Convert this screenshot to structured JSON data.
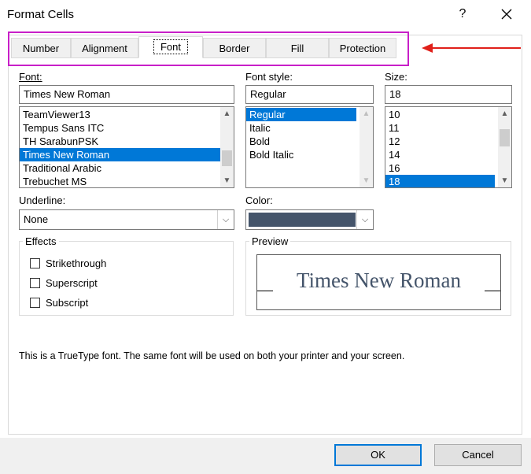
{
  "window": {
    "title": "Format Cells",
    "help": "?"
  },
  "tabs": [
    {
      "label": "Number"
    },
    {
      "label": "Alignment"
    },
    {
      "label": "Font",
      "active": true
    },
    {
      "label": "Border"
    },
    {
      "label": "Fill"
    },
    {
      "label": "Protection"
    }
  ],
  "font": {
    "label": "Font:",
    "value": "Times New Roman",
    "items": [
      "TeamViewer13",
      "Tempus Sans ITC",
      "TH SarabunPSK",
      "Times New Roman",
      "Traditional Arabic",
      "Trebuchet MS"
    ],
    "selected_index": 3
  },
  "font_style": {
    "label": "Font style:",
    "value": "Regular",
    "items": [
      "Regular",
      "Italic",
      "Bold",
      "Bold Italic"
    ],
    "selected_index": 0
  },
  "size": {
    "label": "Size:",
    "value": "18",
    "items": [
      "10",
      "11",
      "12",
      "14",
      "16",
      "18"
    ],
    "selected_index": 5
  },
  "underline": {
    "label": "Underline:",
    "value": "None"
  },
  "color": {
    "label": "Color:",
    "swatch": "#44546a"
  },
  "effects": {
    "title": "Effects",
    "items": [
      {
        "label": "Strikethrough",
        "checked": false
      },
      {
        "label": "Superscript",
        "checked": false
      },
      {
        "label": "Subscript",
        "checked": false
      }
    ]
  },
  "preview": {
    "title": "Preview",
    "text": "Times New Roman",
    "color": "#44546a"
  },
  "info_text": "This is a TrueType font.  The same font will be used on both your printer and your screen.",
  "buttons": {
    "ok": "OK",
    "cancel": "Cancel"
  },
  "accent": {
    "selection": "#0078d7",
    "highlight_box": "#c81fc8",
    "arrow": "#e0201a"
  }
}
